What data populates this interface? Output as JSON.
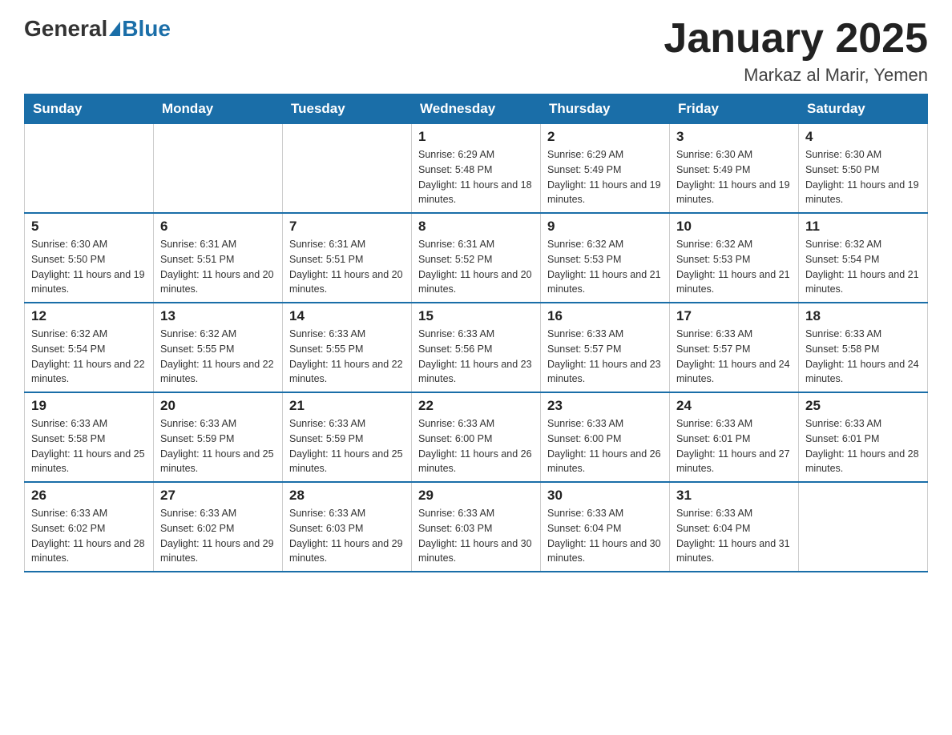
{
  "header": {
    "logo_general": "General",
    "logo_blue": "Blue",
    "month_title": "January 2025",
    "subtitle": "Markaz al Marir, Yemen"
  },
  "days_of_week": [
    "Sunday",
    "Monday",
    "Tuesday",
    "Wednesday",
    "Thursday",
    "Friday",
    "Saturday"
  ],
  "weeks": [
    [
      {
        "day": "",
        "sunrise": "",
        "sunset": "",
        "daylight": ""
      },
      {
        "day": "",
        "sunrise": "",
        "sunset": "",
        "daylight": ""
      },
      {
        "day": "",
        "sunrise": "",
        "sunset": "",
        "daylight": ""
      },
      {
        "day": "1",
        "sunrise": "Sunrise: 6:29 AM",
        "sunset": "Sunset: 5:48 PM",
        "daylight": "Daylight: 11 hours and 18 minutes."
      },
      {
        "day": "2",
        "sunrise": "Sunrise: 6:29 AM",
        "sunset": "Sunset: 5:49 PM",
        "daylight": "Daylight: 11 hours and 19 minutes."
      },
      {
        "day": "3",
        "sunrise": "Sunrise: 6:30 AM",
        "sunset": "Sunset: 5:49 PM",
        "daylight": "Daylight: 11 hours and 19 minutes."
      },
      {
        "day": "4",
        "sunrise": "Sunrise: 6:30 AM",
        "sunset": "Sunset: 5:50 PM",
        "daylight": "Daylight: 11 hours and 19 minutes."
      }
    ],
    [
      {
        "day": "5",
        "sunrise": "Sunrise: 6:30 AM",
        "sunset": "Sunset: 5:50 PM",
        "daylight": "Daylight: 11 hours and 19 minutes."
      },
      {
        "day": "6",
        "sunrise": "Sunrise: 6:31 AM",
        "sunset": "Sunset: 5:51 PM",
        "daylight": "Daylight: 11 hours and 20 minutes."
      },
      {
        "day": "7",
        "sunrise": "Sunrise: 6:31 AM",
        "sunset": "Sunset: 5:51 PM",
        "daylight": "Daylight: 11 hours and 20 minutes."
      },
      {
        "day": "8",
        "sunrise": "Sunrise: 6:31 AM",
        "sunset": "Sunset: 5:52 PM",
        "daylight": "Daylight: 11 hours and 20 minutes."
      },
      {
        "day": "9",
        "sunrise": "Sunrise: 6:32 AM",
        "sunset": "Sunset: 5:53 PM",
        "daylight": "Daylight: 11 hours and 21 minutes."
      },
      {
        "day": "10",
        "sunrise": "Sunrise: 6:32 AM",
        "sunset": "Sunset: 5:53 PM",
        "daylight": "Daylight: 11 hours and 21 minutes."
      },
      {
        "day": "11",
        "sunrise": "Sunrise: 6:32 AM",
        "sunset": "Sunset: 5:54 PM",
        "daylight": "Daylight: 11 hours and 21 minutes."
      }
    ],
    [
      {
        "day": "12",
        "sunrise": "Sunrise: 6:32 AM",
        "sunset": "Sunset: 5:54 PM",
        "daylight": "Daylight: 11 hours and 22 minutes."
      },
      {
        "day": "13",
        "sunrise": "Sunrise: 6:32 AM",
        "sunset": "Sunset: 5:55 PM",
        "daylight": "Daylight: 11 hours and 22 minutes."
      },
      {
        "day": "14",
        "sunrise": "Sunrise: 6:33 AM",
        "sunset": "Sunset: 5:55 PM",
        "daylight": "Daylight: 11 hours and 22 minutes."
      },
      {
        "day": "15",
        "sunrise": "Sunrise: 6:33 AM",
        "sunset": "Sunset: 5:56 PM",
        "daylight": "Daylight: 11 hours and 23 minutes."
      },
      {
        "day": "16",
        "sunrise": "Sunrise: 6:33 AM",
        "sunset": "Sunset: 5:57 PM",
        "daylight": "Daylight: 11 hours and 23 minutes."
      },
      {
        "day": "17",
        "sunrise": "Sunrise: 6:33 AM",
        "sunset": "Sunset: 5:57 PM",
        "daylight": "Daylight: 11 hours and 24 minutes."
      },
      {
        "day": "18",
        "sunrise": "Sunrise: 6:33 AM",
        "sunset": "Sunset: 5:58 PM",
        "daylight": "Daylight: 11 hours and 24 minutes."
      }
    ],
    [
      {
        "day": "19",
        "sunrise": "Sunrise: 6:33 AM",
        "sunset": "Sunset: 5:58 PM",
        "daylight": "Daylight: 11 hours and 25 minutes."
      },
      {
        "day": "20",
        "sunrise": "Sunrise: 6:33 AM",
        "sunset": "Sunset: 5:59 PM",
        "daylight": "Daylight: 11 hours and 25 minutes."
      },
      {
        "day": "21",
        "sunrise": "Sunrise: 6:33 AM",
        "sunset": "Sunset: 5:59 PM",
        "daylight": "Daylight: 11 hours and 25 minutes."
      },
      {
        "day": "22",
        "sunrise": "Sunrise: 6:33 AM",
        "sunset": "Sunset: 6:00 PM",
        "daylight": "Daylight: 11 hours and 26 minutes."
      },
      {
        "day": "23",
        "sunrise": "Sunrise: 6:33 AM",
        "sunset": "Sunset: 6:00 PM",
        "daylight": "Daylight: 11 hours and 26 minutes."
      },
      {
        "day": "24",
        "sunrise": "Sunrise: 6:33 AM",
        "sunset": "Sunset: 6:01 PM",
        "daylight": "Daylight: 11 hours and 27 minutes."
      },
      {
        "day": "25",
        "sunrise": "Sunrise: 6:33 AM",
        "sunset": "Sunset: 6:01 PM",
        "daylight": "Daylight: 11 hours and 28 minutes."
      }
    ],
    [
      {
        "day": "26",
        "sunrise": "Sunrise: 6:33 AM",
        "sunset": "Sunset: 6:02 PM",
        "daylight": "Daylight: 11 hours and 28 minutes."
      },
      {
        "day": "27",
        "sunrise": "Sunrise: 6:33 AM",
        "sunset": "Sunset: 6:02 PM",
        "daylight": "Daylight: 11 hours and 29 minutes."
      },
      {
        "day": "28",
        "sunrise": "Sunrise: 6:33 AM",
        "sunset": "Sunset: 6:03 PM",
        "daylight": "Daylight: 11 hours and 29 minutes."
      },
      {
        "day": "29",
        "sunrise": "Sunrise: 6:33 AM",
        "sunset": "Sunset: 6:03 PM",
        "daylight": "Daylight: 11 hours and 30 minutes."
      },
      {
        "day": "30",
        "sunrise": "Sunrise: 6:33 AM",
        "sunset": "Sunset: 6:04 PM",
        "daylight": "Daylight: 11 hours and 30 minutes."
      },
      {
        "day": "31",
        "sunrise": "Sunrise: 6:33 AM",
        "sunset": "Sunset: 6:04 PM",
        "daylight": "Daylight: 11 hours and 31 minutes."
      },
      {
        "day": "",
        "sunrise": "",
        "sunset": "",
        "daylight": ""
      }
    ]
  ]
}
